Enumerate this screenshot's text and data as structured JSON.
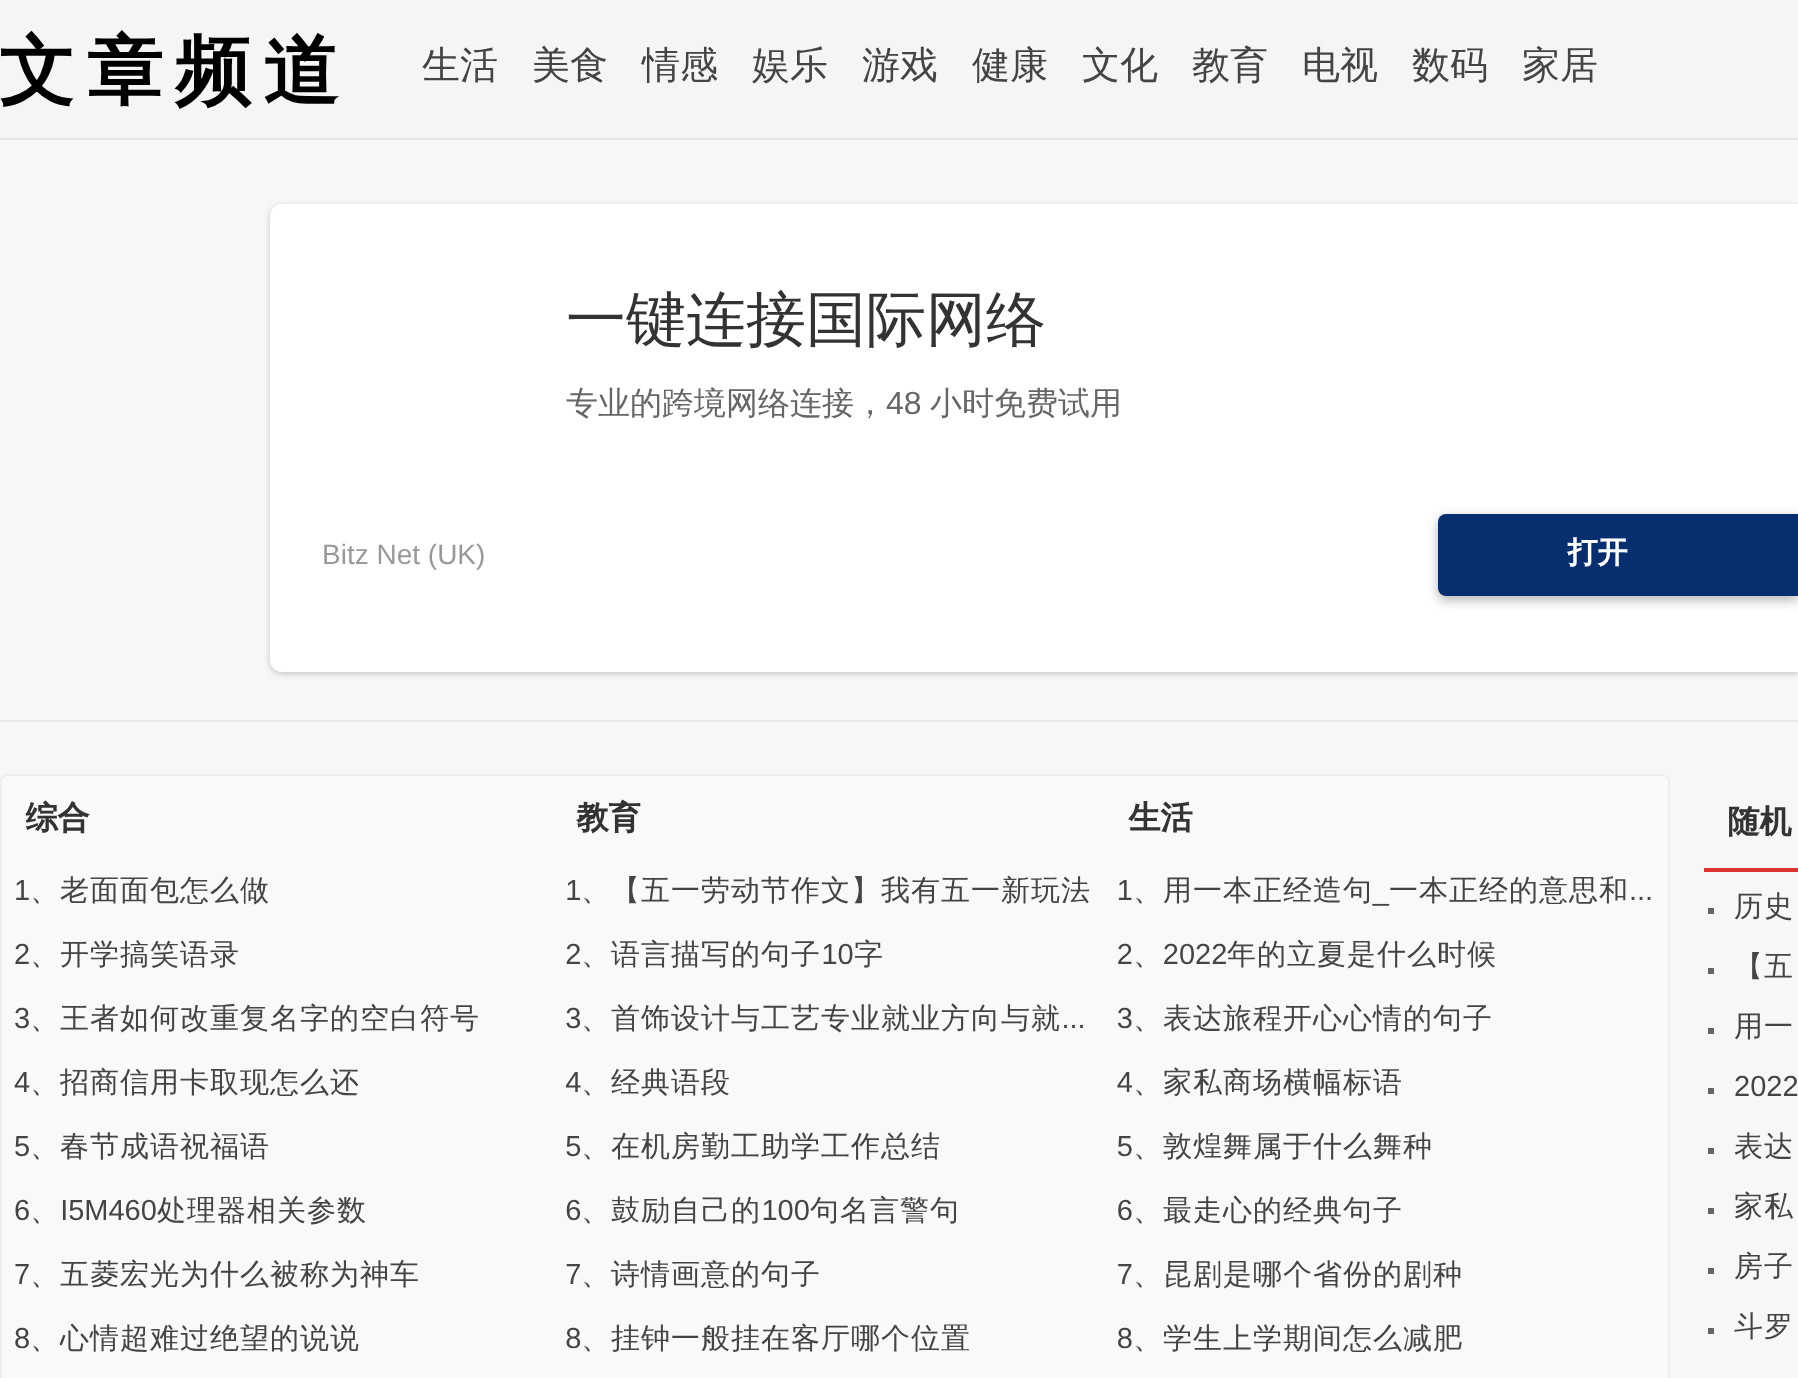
{
  "logo": "文章频道",
  "nav": [
    "生活",
    "美食",
    "情感",
    "娱乐",
    "游戏",
    "健康",
    "文化",
    "教育",
    "电视",
    "数码",
    "家居"
  ],
  "ad": {
    "title": "一键连接国际网络",
    "subtitle": "专业的跨境网络连接，48 小时免费试用",
    "advertiser": "Bitz Net (UK)",
    "button": "打开"
  },
  "columns": [
    {
      "title": "综合",
      "items": [
        "1、老面面包怎么做",
        "2、开学搞笑语录",
        "3、王者如何改重复名字的空白符号",
        "4、招商信用卡取现怎么还",
        "5、春节成语祝福语",
        "6、I5M460处理器相关参数",
        "7、五菱宏光为什么被称为神车",
        "8、心情超难过绝望的说说"
      ]
    },
    {
      "title": "教育",
      "items": [
        "1、【五一劳动节作文】我有五一新玩法",
        "2、语言描写的句子10字",
        "3、首饰设计与工艺专业就业方向与就...",
        "4、经典语段",
        "5、在机房勤工助学工作总结",
        "6、鼓励自己的100句名言警句",
        "7、诗情画意的句子",
        "8、挂钟一般挂在客厅哪个位置"
      ]
    },
    {
      "title": "生活",
      "items": [
        "1、用一本正经造句_一本正经的意思和...",
        "2、2022年的立夏是什么时候",
        "3、表达旅程开心心情的句子",
        "4、家私商场横幅标语",
        "5、敦煌舞属于什么舞种",
        "6、最走心的经典句子",
        "7、昆剧是哪个省份的剧种",
        "8、学生上学期间怎么减肥"
      ]
    }
  ],
  "sidebar": {
    "title": "随机",
    "items": [
      "历史",
      "【五",
      "用一",
      "2022",
      "表达",
      "家私",
      "房子",
      "斗罗"
    ]
  }
}
